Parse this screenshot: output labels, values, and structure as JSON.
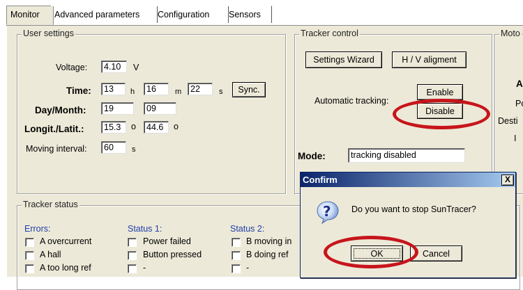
{
  "tabs": [
    "Monitor",
    "Advanced parameters",
    "Configuration",
    "Sensors"
  ],
  "user_settings": {
    "title": "User settings",
    "voltage_label": "Voltage:",
    "voltage_value": "4.10",
    "voltage_unit": "V",
    "time_label": "Time:",
    "time_h": "13",
    "time_h_unit": "h",
    "time_m": "16",
    "time_m_unit": "m",
    "time_s": "22",
    "time_s_unit": "s",
    "sync_label": "Sync.",
    "daymonth_label": "Day/Month:",
    "day": "19",
    "month": "09",
    "longlat_label": "Longit./Latit.:",
    "longitude": "15.3",
    "latitude": "44.6",
    "degree_unit": "o",
    "moving_label": "Moving interval:",
    "moving_value": "60",
    "moving_unit": "s"
  },
  "tracker_control": {
    "title": "Tracker control",
    "wizard_label": "Settings Wizard",
    "hv_label": "H / V aligment",
    "auto_label": "Automatic tracking:",
    "enable_label": "Enable",
    "disable_label": "Disable",
    "mode_label": "Mode:",
    "mode_value": "tracking disabled"
  },
  "motor": {
    "title": "Moto",
    "line1": "A",
    "line2": "Po",
    "line3": "Desti",
    "line4": "I"
  },
  "tracker_status": {
    "title": "Tracker status",
    "errors_header": "Errors:",
    "status1_header": "Status 1:",
    "status2_header": "Status 2:",
    "errors": [
      "A overcurrent",
      "A hall",
      "A too long ref"
    ],
    "status1": [
      "Power failed",
      "Button pressed",
      "-"
    ],
    "status2": [
      "B moving in",
      "B doing ref",
      "-"
    ]
  },
  "dialog": {
    "title": "Confirm",
    "close_glyph": "X",
    "icon_glyph": "?",
    "message": "Do you want to stop SunTracer?",
    "ok_label": "OK",
    "cancel_label": "Cancel"
  },
  "colors": {
    "highlight_ring": "#c7151b",
    "status_header": "#1f3ea8",
    "dialog_title": "#0a246a"
  }
}
